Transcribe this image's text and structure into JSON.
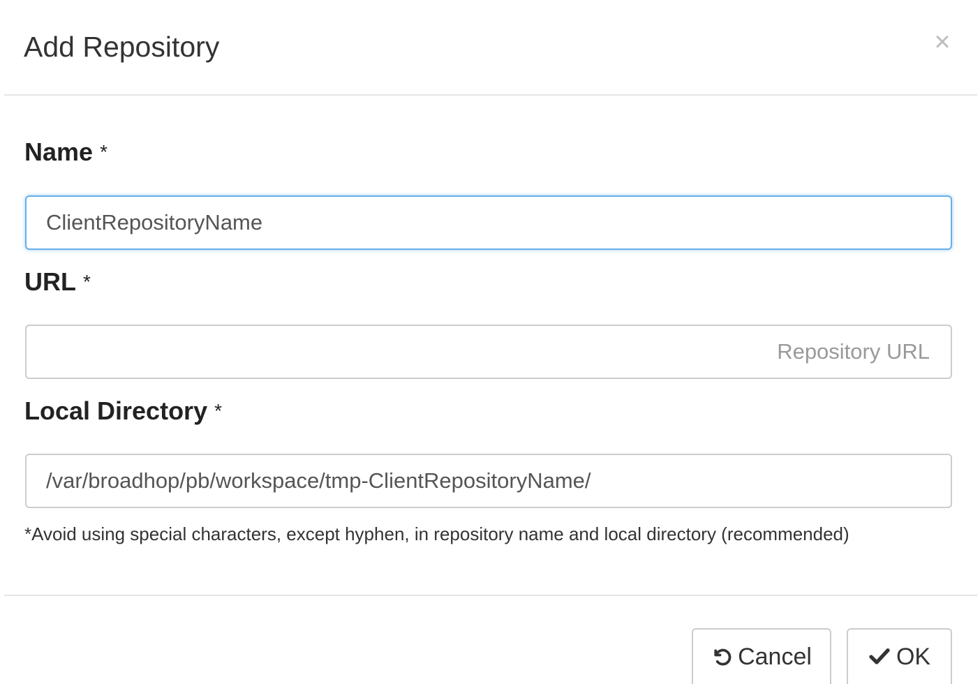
{
  "dialog": {
    "title": "Add Repository",
    "close_glyph": "×"
  },
  "form": {
    "name": {
      "label": "Name",
      "required_marker": "*",
      "value": "ClientRepositoryName",
      "placeholder": ""
    },
    "url": {
      "label": "URL",
      "required_marker": "*",
      "value": "",
      "placeholder": "Repository URL"
    },
    "local_directory": {
      "label": "Local Directory",
      "required_marker": "*",
      "value": "/var/broadhop/pb/workspace/tmp-ClientRepositoryName/",
      "placeholder": ""
    },
    "hint": "*Avoid using special characters, except hyphen, in repository name and local directory (recommended)"
  },
  "footer": {
    "cancel_label": "Cancel",
    "cancel_icon": "undo-icon",
    "ok_label": "OK",
    "ok_icon": "check-icon"
  },
  "colors": {
    "focus_border": "#66afe9",
    "border": "#cccccc",
    "text": "#333333"
  }
}
